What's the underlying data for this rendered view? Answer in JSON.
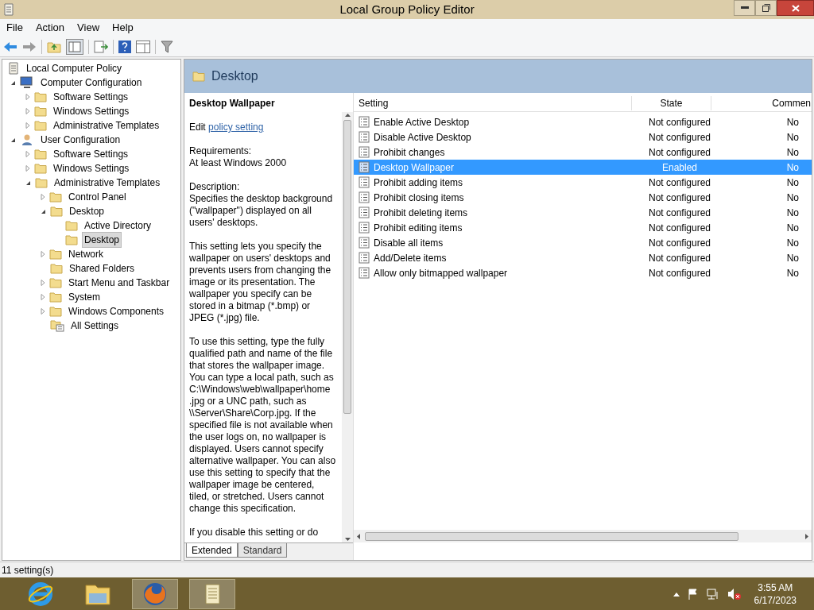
{
  "window": {
    "title": "Local Group Policy Editor"
  },
  "menu": [
    "File",
    "Action",
    "View",
    "Help"
  ],
  "tree": [
    {
      "label": "Local Computer Policy",
      "kind": "root",
      "selected": false,
      "children": [
        {
          "label": "Computer Configuration",
          "kind": "computer",
          "expanded": true,
          "selected": false,
          "children": [
            {
              "label": "Software Settings",
              "kind": "folder",
              "expanded": false,
              "selected": false
            },
            {
              "label": "Windows Settings",
              "kind": "folder",
              "expanded": false,
              "selected": false
            },
            {
              "label": "Administrative Templates",
              "kind": "folder",
              "expanded": false,
              "selected": false
            }
          ]
        },
        {
          "label": "User Configuration",
          "kind": "user",
          "expanded": true,
          "selected": false,
          "children": [
            {
              "label": "Software Settings",
              "kind": "folder",
              "expanded": false,
              "selected": false
            },
            {
              "label": "Windows Settings",
              "kind": "folder",
              "expanded": false,
              "selected": false
            },
            {
              "label": "Administrative Templates",
              "kind": "folder",
              "expanded": true,
              "selected": false,
              "children": [
                {
                  "label": "Control Panel",
                  "kind": "folder",
                  "expanded": false,
                  "selected": false
                },
                {
                  "label": "Desktop",
                  "kind": "folder",
                  "expanded": true,
                  "selected": false,
                  "children": [
                    {
                      "label": "Active Directory",
                      "kind": "folder",
                      "selected": false
                    },
                    {
                      "label": "Desktop",
                      "kind": "folder",
                      "selected": true
                    }
                  ]
                },
                {
                  "label": "Network",
                  "kind": "folder",
                  "expanded": false,
                  "selected": false
                },
                {
                  "label": "Shared Folders",
                  "kind": "folder",
                  "selected": false
                },
                {
                  "label": "Start Menu and Taskbar",
                  "kind": "folder",
                  "expanded": false,
                  "selected": false
                },
                {
                  "label": "System",
                  "kind": "folder",
                  "expanded": false,
                  "selected": false
                },
                {
                  "label": "Windows Components",
                  "kind": "folder",
                  "expanded": false,
                  "selected": false
                },
                {
                  "label": "All Settings",
                  "kind": "all-settings",
                  "selected": false
                }
              ]
            }
          ]
        }
      ]
    }
  ],
  "header": {
    "title": "Desktop"
  },
  "description": {
    "title": "Desktop Wallpaper",
    "edit_prefix": "Edit",
    "edit_link": "policy setting",
    "paragraphs": [
      "Requirements:\nAt least Windows 2000",
      "Description:\nSpecifies the desktop background (\"wallpaper\") displayed on all users' desktops.",
      "This setting lets you specify the wallpaper on users' desktops and prevents users from changing the image or its presentation. The wallpaper you specify can be stored in a bitmap (*.bmp) or JPEG (*.jpg) file.",
      "To use this setting, type the fully qualified path and name of the file that stores the wallpaper image. You can type a local path, such as C:\\Windows\\web\\wallpaper\\home .jpg or a UNC path, such as \\\\Server\\Share\\Corp.jpg. If the specified file is not available when the user logs on, no wallpaper is displayed. Users cannot specify alternative wallpaper. You can also use this setting to specify that the wallpaper image be centered, tiled, or stretched. Users cannot change this specification.",
      "If you disable this setting or do"
    ]
  },
  "table": {
    "columns": [
      "Setting",
      "State",
      "Commen"
    ],
    "rows": [
      {
        "setting": "Enable Active Desktop",
        "state": "Not configured",
        "comment": "No",
        "selected": false
      },
      {
        "setting": "Disable Active Desktop",
        "state": "Not configured",
        "comment": "No",
        "selected": false
      },
      {
        "setting": "Prohibit changes",
        "state": "Not configured",
        "comment": "No",
        "selected": false
      },
      {
        "setting": "Desktop Wallpaper",
        "state": "Enabled",
        "comment": "No",
        "selected": true
      },
      {
        "setting": "Prohibit adding items",
        "state": "Not configured",
        "comment": "No",
        "selected": false
      },
      {
        "setting": "Prohibit closing items",
        "state": "Not configured",
        "comment": "No",
        "selected": false
      },
      {
        "setting": "Prohibit deleting items",
        "state": "Not configured",
        "comment": "No",
        "selected": false
      },
      {
        "setting": "Prohibit editing items",
        "state": "Not configured",
        "comment": "No",
        "selected": false
      },
      {
        "setting": "Disable all items",
        "state": "Not configured",
        "comment": "No",
        "selected": false
      },
      {
        "setting": "Add/Delete items",
        "state": "Not configured",
        "comment": "No",
        "selected": false
      },
      {
        "setting": "Allow only bitmapped wallpaper",
        "state": "Not configured",
        "comment": "No",
        "selected": false
      }
    ]
  },
  "view_tabs": [
    {
      "label": "Extended",
      "selected": true
    },
    {
      "label": "Standard",
      "selected": false
    }
  ],
  "status_bar": "11 setting(s)",
  "taskbar": {
    "apps": [
      {
        "kind": "ie",
        "active": false
      },
      {
        "kind": "explorer",
        "active": false
      },
      {
        "kind": "firefox",
        "active": true
      },
      {
        "kind": "notepad",
        "active": true
      }
    ],
    "time": "3:55 AM",
    "date": "6/17/2023"
  }
}
